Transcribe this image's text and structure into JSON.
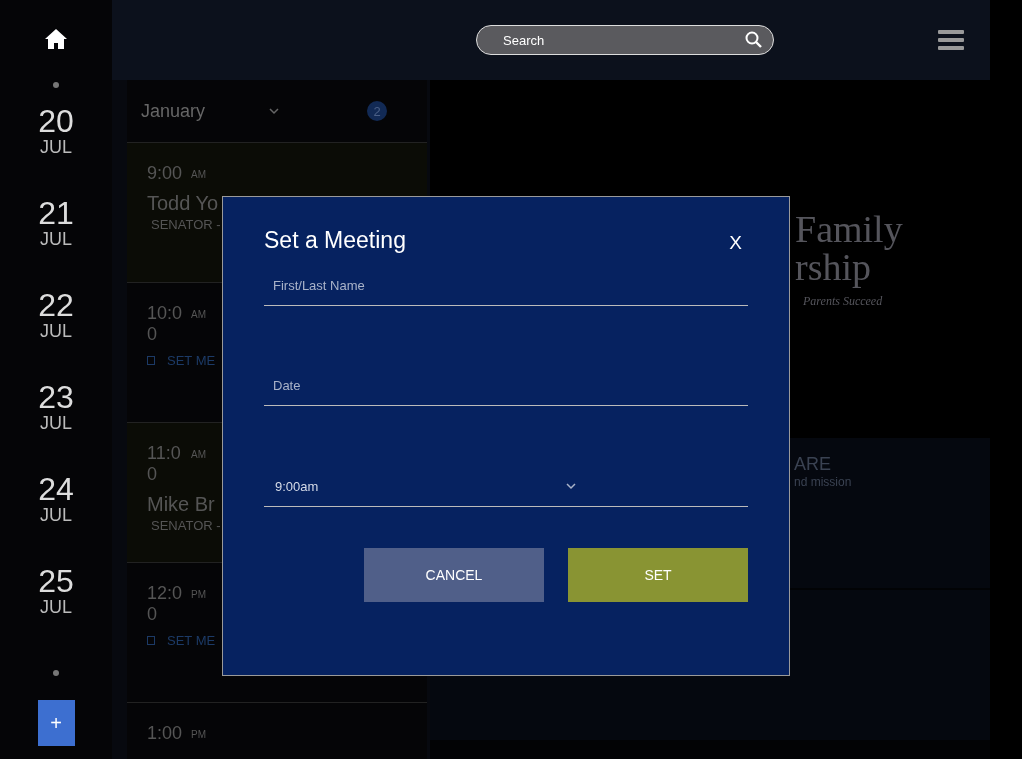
{
  "top_bar": {
    "search": {
      "placeholder": "Search"
    }
  },
  "dates": [
    {
      "day": "20",
      "month": "JUL"
    },
    {
      "day": "21",
      "month": "JUL"
    },
    {
      "day": "22",
      "month": "JUL"
    },
    {
      "day": "23",
      "month": "JUL"
    },
    {
      "day": "24",
      "month": "JUL"
    },
    {
      "day": "25",
      "month": "JUL"
    }
  ],
  "add_button": "+",
  "calendar": {
    "month": "January",
    "count": "2",
    "slots": [
      {
        "kind": "person",
        "time": "9:00",
        "period": "AM",
        "name": "Todd Yo",
        "role": "SENATOR -"
      },
      {
        "kind": "open",
        "time": "10:00",
        "period": "AM",
        "action": "SET ME"
      },
      {
        "kind": "person",
        "time": "11:00",
        "period": "AM",
        "name": "Mike Br",
        "role": "SENATOR -"
      },
      {
        "kind": "open",
        "time": "12:00",
        "period": "PM",
        "action": "SET ME"
      },
      {
        "kind": "empty",
        "time": "1:00",
        "period": "PM"
      }
    ]
  },
  "panel": {
    "logo": {
      "line1": "Family",
      "line2": "rship",
      "tagline": "Parents Succeed"
    },
    "tiles": [
      {
        "title": "ARE",
        "subtitle": "nd mission"
      }
    ]
  },
  "modal": {
    "title": "Set a Meeting",
    "close": "X",
    "fields": [
      {
        "kind": "text",
        "placeholder": "First/Last Name"
      },
      {
        "kind": "text",
        "placeholder": "Date"
      },
      {
        "kind": "select",
        "value": "9:00am"
      }
    ],
    "buttons": [
      {
        "kind": "cancel",
        "label": "CANCEL"
      },
      {
        "kind": "confirm",
        "label": "SET"
      }
    ]
  }
}
